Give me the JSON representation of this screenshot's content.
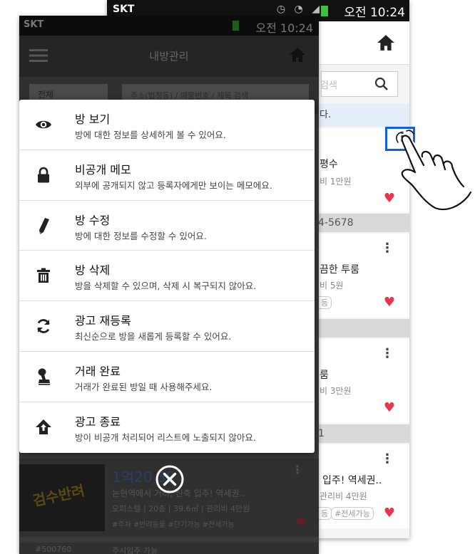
{
  "back_screen": {
    "status": {
      "carrier": "SKT",
      "time": "오전 10:24"
    },
    "search_placeholder": "검색",
    "notice_fragment": "다.",
    "cards": [
      {
        "title": "평수",
        "subtitle": "비 1만원"
      },
      {
        "title": "끔한 투룸",
        "subtitle": "비 5원",
        "tag": "등"
      },
      {
        "title": "룸",
        "subtitle": "비 3만원"
      },
      {
        "title": "입주! 역세권..",
        "subtitle": "관리비 4만원",
        "tags": [
          "등",
          "#전세가능"
        ]
      }
    ],
    "separators": [
      "4-5678",
      "1"
    ]
  },
  "front_screen": {
    "status": {
      "carrier": "SKT",
      "time": "오전 10:24"
    },
    "header_title": "내방관리",
    "filter_select": "전체",
    "search_placeholder": "주소(법정동) / 매물번호 / 제목 검색",
    "list_item": {
      "thumb_text": "검수반려",
      "price": "1억20  30",
      "desc": "논현역에서   거리, 신축 입주! 역세권..",
      "meta": "오피스텔 | 20층 | 39.6㎡ | 관리비 4만원",
      "tags": "#주차  #반려동물  #단기가능  #전세가능"
    },
    "bottom_code": "#500760",
    "bottom_text": "주시임주 가능"
  },
  "menu": {
    "items": [
      {
        "label": "방 보기",
        "desc": "방에 대한 정보를 상세하게 볼 수 있어요.",
        "icon": "eye-icon"
      },
      {
        "label": "비공개 메모",
        "desc": "외부에 공개되지 않고 등록자에게만 보이는 메모에요.",
        "icon": "lock-icon"
      },
      {
        "label": "방 수정",
        "desc": "방에 대한 정보를 수정할 수 있어요.",
        "icon": "pencil-icon"
      },
      {
        "label": "방 삭제",
        "desc": "방을 삭제할 수 있으며, 삭제 시 복구되지 않아요.",
        "icon": "trash-icon"
      },
      {
        "label": "광고 재등록",
        "desc": "최신순으로 방을 새롭게 등록할 수 있어요.",
        "icon": "refresh-icon"
      },
      {
        "label": "거래 완료",
        "desc": "거래가 완료된 방일 때 사용해주세요.",
        "icon": "stamp-icon"
      },
      {
        "label": "광고 종료",
        "desc": "방이 비공개 처리되어 리스트에 노출되지 않아요.",
        "icon": "upload-arrow-icon"
      }
    ]
  },
  "colors": {
    "highlight": "#1160e0",
    "heart": "#e8344e",
    "overlay": "#3a3a3a"
  }
}
